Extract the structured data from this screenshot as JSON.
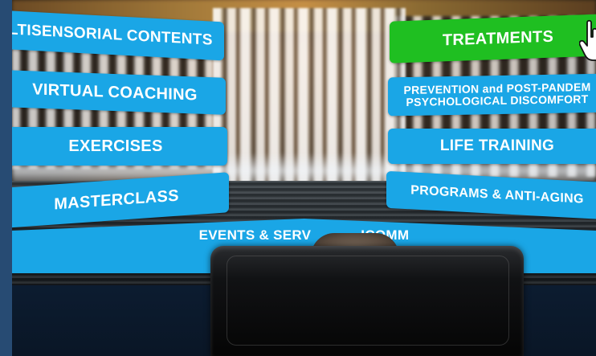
{
  "menu": {
    "left": [
      {
        "label": "LTISENSORIAL CONTENTS"
      },
      {
        "label": "VIRTUAL COACHING"
      },
      {
        "label": "EXERCISES"
      },
      {
        "label": "MASTERCLASS"
      }
    ],
    "right": [
      {
        "label": "TREATMENTS"
      },
      {
        "line1": "PREVENTION and POST-PANDEM",
        "line2": "PSYCHOLOGICAL DISCOMFORT"
      },
      {
        "label": "LIFE TRAINING"
      },
      {
        "label": "PROGRAMS & ANTI-AGING"
      }
    ],
    "bottom": {
      "label": "EVENTS & SERV",
      "label_tail": "ICOMM"
    }
  },
  "colors": {
    "button_blue": "#1aa6e6",
    "button_selected_green": "#1fbf21",
    "frame_blue": "#274b73"
  },
  "icons": [
    "hand-pointer-icon"
  ]
}
